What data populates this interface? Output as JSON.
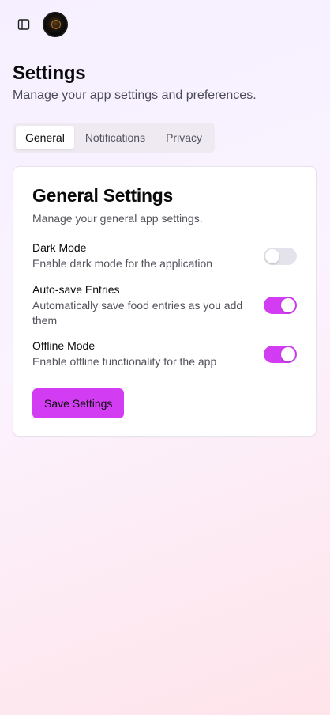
{
  "header": {
    "title": "Settings",
    "subtitle": "Manage your app settings and preferences."
  },
  "tabs": [
    {
      "label": "General",
      "active": true
    },
    {
      "label": "Notifications",
      "active": false
    },
    {
      "label": "Privacy",
      "active": false
    }
  ],
  "general": {
    "title": "General Settings",
    "description": "Manage your general app settings.",
    "settings": [
      {
        "label": "Dark Mode",
        "description": "Enable dark mode for the application",
        "enabled": false
      },
      {
        "label": "Auto-save Entries",
        "description": "Automatically save food entries as you add them",
        "enabled": true
      },
      {
        "label": "Offline Mode",
        "description": "Enable offline functionality for the app",
        "enabled": true
      }
    ],
    "save_label": "Save Settings"
  },
  "icons": {
    "sidebar_toggle": "sidebar-toggle-icon",
    "avatar": "avatar"
  },
  "colors": {
    "accent": "#d23cf2",
    "toggle_off": "#e4e2ea"
  }
}
